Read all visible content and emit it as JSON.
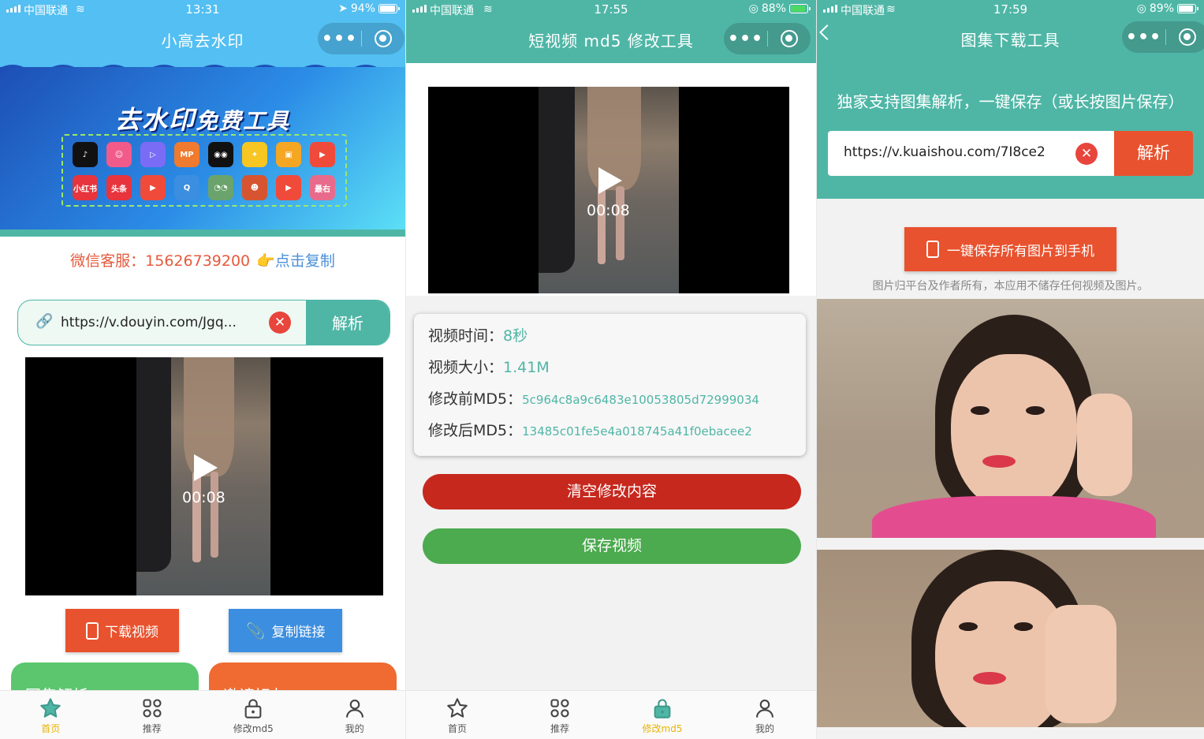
{
  "screen1": {
    "status": {
      "carrier": "中国联通",
      "time": "13:31",
      "battery": "94%"
    },
    "nav_title": "小高去水印",
    "banner": {
      "title": "去水印",
      "subtitle": "免费工具"
    },
    "app_icons": [
      {
        "name": "tiktok-icon",
        "label": "♪",
        "color": "#111111"
      },
      {
        "name": "weishi-icon",
        "label": "☺",
        "color": "#f25a8a"
      },
      {
        "name": "video-play-icon",
        "label": "▷",
        "color": "#7b6cf6"
      },
      {
        "name": "mp-icon",
        "label": "MP",
        "color": "#f07a2d"
      },
      {
        "name": "eyes-icon",
        "label": "◉◉",
        "color": "#111111"
      },
      {
        "name": "chick-icon",
        "label": "✦",
        "color": "#f7c623"
      },
      {
        "name": "kuaishou-icon",
        "label": "▣",
        "color": "#f5a623"
      },
      {
        "name": "red-play-icon",
        "label": "▶",
        "color": "#f04a3a"
      },
      {
        "name": "xiaohongshu-icon",
        "label": "小红书",
        "color": "#e8343c"
      },
      {
        "name": "toutiao-icon",
        "label": "头条",
        "color": "#e8343c"
      },
      {
        "name": "weibo-video-icon",
        "label": "▶",
        "color": "#f04a3a"
      },
      {
        "name": "q-icon",
        "label": "Q",
        "color": "#3b8ee0"
      },
      {
        "name": "owl-icon",
        "label": "◔◔",
        "color": "#6aa36b"
      },
      {
        "name": "face-icon",
        "label": "☻",
        "color": "#d6542f"
      },
      {
        "name": "pipi-icon",
        "label": "▶",
        "color": "#f04a3a"
      },
      {
        "name": "zuiyou-icon",
        "label": "最右",
        "color": "#e86b8c"
      }
    ],
    "service": {
      "label": "微信客服：",
      "phone": "15626739200",
      "copy": "👉点击复制"
    },
    "search": {
      "value": "https://v.douyin.com/Jgq...",
      "parse": "解析"
    },
    "video_time": "00:08",
    "buttons": {
      "download": "下载视频",
      "copy_link": "复制链接"
    },
    "cards": {
      "gallery": "图集解析",
      "invite": "邀请好友"
    },
    "tabs": [
      {
        "label": "首页",
        "icon": "star-icon",
        "active": true
      },
      {
        "label": "推荐",
        "icon": "grid-icon",
        "active": false
      },
      {
        "label": "修改md5",
        "icon": "lock-icon",
        "active": false
      },
      {
        "label": "我的",
        "icon": "user-icon",
        "active": false
      }
    ]
  },
  "screen2": {
    "status": {
      "carrier": "中国联通",
      "time": "17:55",
      "battery": "88%"
    },
    "nav_title": "短视频 md5 修改工具",
    "video_time": "00:08",
    "info": {
      "duration_label": "视频时间：",
      "duration": "8秒",
      "size_label": "视频大小：",
      "size": "1.41M",
      "before_label": "修改前MD5：",
      "before": "5c964c8a9c6483e10053805d72999034",
      "after_label": "修改后MD5：",
      "after": "13485c01fe5e4a018745a41f0ebacee2"
    },
    "buttons": {
      "clear": "清空修改内容",
      "save": "保存视频"
    },
    "tabs": [
      {
        "label": "首页",
        "icon": "star-icon",
        "active": false
      },
      {
        "label": "推荐",
        "icon": "grid-icon",
        "active": false
      },
      {
        "label": "修改md5",
        "icon": "lock-icon",
        "active": true
      },
      {
        "label": "我的",
        "icon": "user-icon",
        "active": false
      }
    ]
  },
  "screen3": {
    "status": {
      "carrier": "中国联通",
      "time": "17:59",
      "battery": "89%"
    },
    "nav_title": "图集下载工具",
    "tip": "独家支持图集解析，一键保存（或长按图片保存）",
    "search": {
      "value": "https://v.kuaishou.com/7I8ce2",
      "parse": "解析"
    },
    "save_all": "一键保存所有图片到手机",
    "disclaimer": "图片归平台及作者所有，本应用不储存任何视频及图片。"
  },
  "colors": {
    "teal": "#4fb6a6",
    "orange": "#e8522e",
    "blue": "#3b8ee0",
    "active_tab": "#e8b400"
  }
}
